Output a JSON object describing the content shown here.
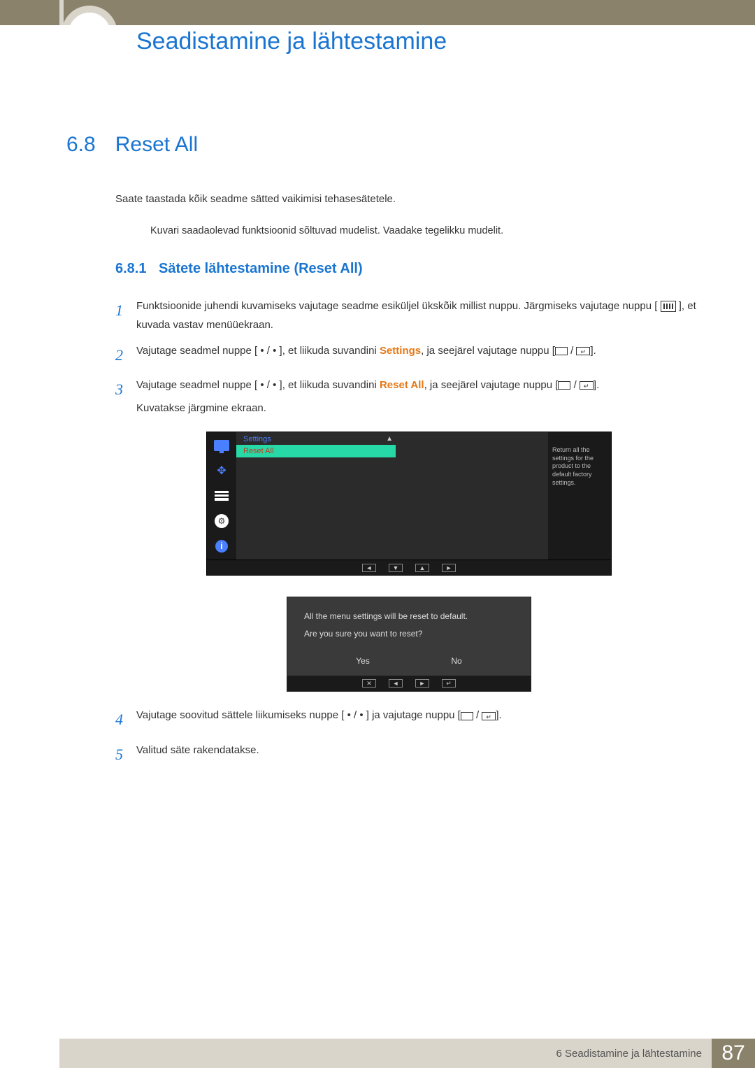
{
  "chapter_title": "Seadistamine ja lähtestamine",
  "section": {
    "num": "6.8",
    "title": "Reset All"
  },
  "intro": "Saate taastada kõik seadme sätted vaikimisi tehasesätetele.",
  "note": "Kuvari saadaolevad funktsioonid sõltuvad mudelist. Vaadake tegelikku mudelit.",
  "subsection": {
    "num": "6.8.1",
    "title": "Sätete lähtestamine (Reset All)"
  },
  "steps": {
    "s1a": "Funktsioonide juhendi kuvamiseks vajutage seadme esiküljel ükskõik millist nuppu. Järgmiseks vajutage nuppu [",
    "s1b": "], et kuvada vastav menüüekraan.",
    "s2a": "Vajutage seadmel nuppe [",
    "s2mid": "], et liikuda suvandini ",
    "s2hl": "Settings",
    "s2b": ", ja seejärel vajutage nuppu [",
    "s2c": "].",
    "s3a": "Vajutage seadmel nuppe [",
    "s3mid": "], et liikuda suvandini ",
    "s3hl": "Reset All",
    "s3b": ", ja seejärel vajutage nuppu [",
    "s3c": "].",
    "s3d": "Kuvatakse järgmine ekraan.",
    "s4a": "Vajutage soovitud sättele liikumiseks nuppe [",
    "s4b": "] ja vajutage nuppu [",
    "s4c": "].",
    "s5": "Valitud säte rakendatakse.",
    "dots": " • / • "
  },
  "osd1": {
    "header": "Settings",
    "selected": "Reset All",
    "help": "Return all the settings for the product to the default factory settings."
  },
  "osd2": {
    "line1": "All the menu settings will be reset to default.",
    "line2": "Are you sure you want to reset?",
    "yes": "Yes",
    "no": "No"
  },
  "footer": {
    "text": "6 Seadistamine ja lähtestamine",
    "page": "87"
  }
}
